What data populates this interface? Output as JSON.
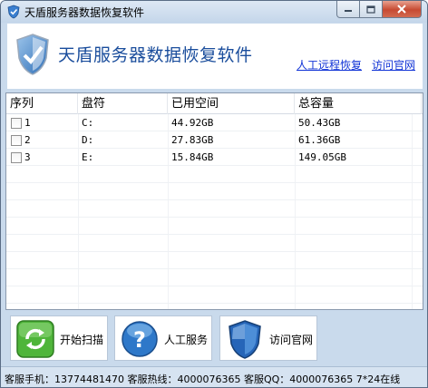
{
  "window": {
    "title": "天盾服务器数据恢复软件"
  },
  "header": {
    "app_title": "天盾服务器数据恢复软件",
    "link_remote": "人工远程恢复",
    "link_site": "访问官网"
  },
  "table": {
    "columns": [
      "序列",
      "盘符",
      "已用空间",
      "总容量"
    ],
    "rows": [
      {
        "index": "1",
        "drive": "C:",
        "used": "44.92GB",
        "total": "50.43GB",
        "checked": false
      },
      {
        "index": "2",
        "drive": "D:",
        "used": "27.83GB",
        "total": "61.36GB",
        "checked": false
      },
      {
        "index": "3",
        "drive": "E:",
        "used": "15.84GB",
        "total": "149.05GB",
        "checked": false
      }
    ]
  },
  "actions": {
    "scan": {
      "label": "开始扫描",
      "icon": "refresh-icon"
    },
    "service": {
      "label": "人工服务",
      "icon": "help-icon"
    },
    "site": {
      "label": "访问官网",
      "icon": "shield-icon"
    }
  },
  "status": {
    "text": "客服手机：13774481470 客服热线：4000076365 客服QQ：4000076365 7*24在线"
  },
  "colors": {
    "title_blue": "#1a4d9c",
    "link_blue": "#1033d6",
    "frame": "#c9daec"
  }
}
